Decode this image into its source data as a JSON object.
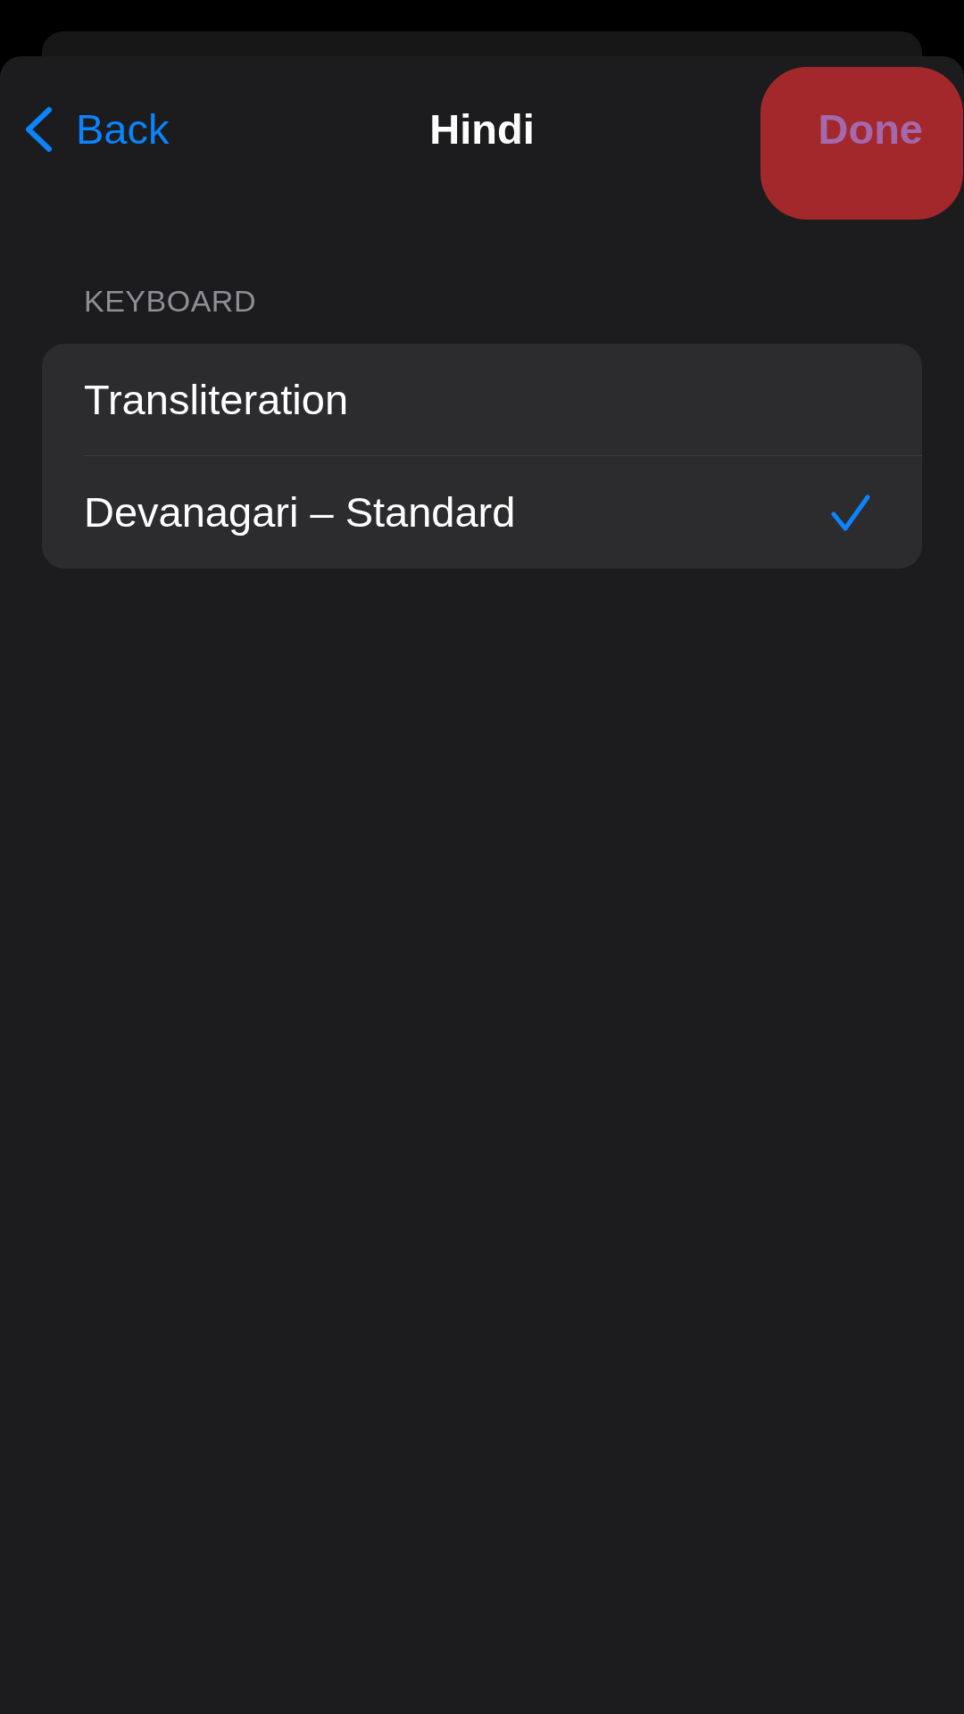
{
  "nav": {
    "back_label": "Back",
    "title": "Hindi",
    "done": {
      "label": "Done",
      "highlighted": true
    }
  },
  "section": {
    "header": "KEYBOARD",
    "rows": [
      {
        "label": "Transliteration",
        "selected": false
      },
      {
        "label": "Devanagari – Standard",
        "selected": true
      }
    ]
  }
}
